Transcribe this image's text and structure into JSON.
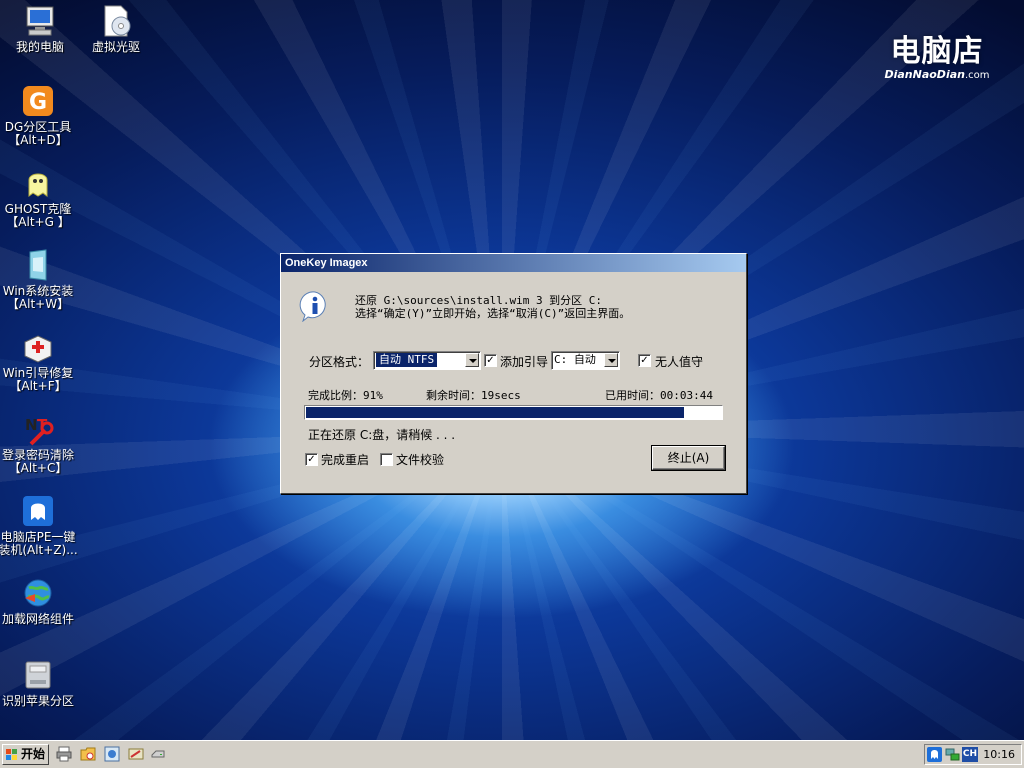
{
  "desktop": {
    "icons": [
      {
        "label": "我的电脑",
        "icon": "my-computer-icon"
      },
      {
        "label": "虚拟光驱",
        "icon": "virtual-drive-icon"
      },
      {
        "label": "DG分区工具\n【Alt+D】",
        "icon": "dg-partition-icon"
      },
      {
        "label": "GHOST克隆\n【Alt+G 】",
        "icon": "ghost-icon"
      },
      {
        "label": "Win系统安装\n【Alt+W】",
        "icon": "win-install-icon"
      },
      {
        "label": "Win引导修复\n【Alt+F】",
        "icon": "boot-repair-icon"
      },
      {
        "label": "登录密码清除\n【Alt+C】",
        "icon": "password-clear-icon"
      },
      {
        "label": "电脑店PE一键\n装机(Alt+Z)...",
        "icon": "pe-installer-icon"
      },
      {
        "label": "加载网络组件",
        "icon": "network-icon"
      },
      {
        "label": "识别苹果分区",
        "icon": "apple-partition-icon"
      }
    ]
  },
  "brand": {
    "name": "电脑店",
    "site_bold": "DianNaoDian",
    "site_suffix": ".com"
  },
  "dialog": {
    "title": "OneKey Imagex",
    "message_line1": "还原 G:\\sources\\install.wim 3 到分区 C:",
    "message_line2": "选择“确定(Y)”立即开始，选择“取消(C)”返回主界面。",
    "format_label": "分区格式：",
    "format_value": "自动 NTFS",
    "add_boot_label": "添加引导",
    "add_boot_checked": true,
    "boot_drive_value": "C: 自动",
    "unattended_label": "无人值守",
    "unattended_checked": true,
    "progress_label": "完成比例：91%",
    "remaining_label": "剩余时间：19secs",
    "elapsed_label": "已用时间：00:03:44",
    "progress_percent": 91,
    "status_text": "正在还原 C:盘，请稍候 . . .",
    "restart_label": "完成重启",
    "restart_checked": true,
    "verify_label": "文件校验",
    "verify_checked": false,
    "abort_button": "终止(A)"
  },
  "taskbar": {
    "start_label": "开始",
    "quick_launch": [
      "printer-icon",
      "folder-icon",
      "image-icon",
      "tool-icon"
    ],
    "tray": {
      "ime_label": "CH",
      "clock": "10:16"
    }
  }
}
